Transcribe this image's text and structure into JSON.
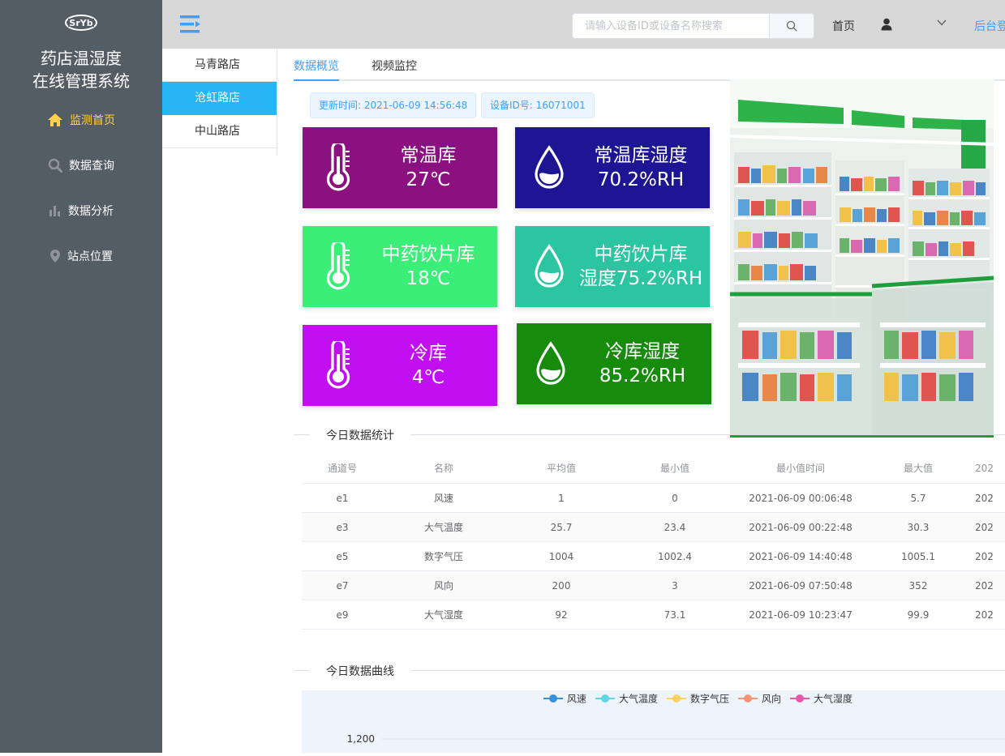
{
  "sidebar": {
    "logo_text": "SrYb",
    "title_line1": "药店温湿度",
    "title_line2": "在线管理系统",
    "items": [
      {
        "label": "监测首页",
        "icon": "home-icon",
        "active": true
      },
      {
        "label": "数据查询",
        "icon": "search-icon"
      },
      {
        "label": "数据分析",
        "icon": "bar-chart-icon"
      },
      {
        "label": "站点位置",
        "icon": "location-pin-icon"
      }
    ],
    "active_color": "#ffd04b",
    "bg_color": "#545c64"
  },
  "header": {
    "search_placeholder": "请输入设备ID或设备名称搜索",
    "home_label": "首页",
    "admin_label": "后台登"
  },
  "stores": [
    {
      "label": "马青路店"
    },
    {
      "label": "沧虹路店",
      "active": true
    },
    {
      "label": "中山路店"
    }
  ],
  "tabs": [
    {
      "label": "数据概览",
      "active": true
    },
    {
      "label": "视频监控"
    }
  ],
  "info": {
    "update_time": "更新时间: 2021-06-09 14:56:48",
    "device_id": "设备ID号: 16071001"
  },
  "cards": [
    {
      "line1": "常温库",
      "line2": "27℃",
      "icon": "thermometer-icon",
      "color": "#8c1180"
    },
    {
      "line1": "常温库湿度",
      "line2": "70.2%RH",
      "icon": "water-drop-icon",
      "color": "#1e1594"
    },
    {
      "line1": "中药饮片库",
      "line2": "18℃",
      "icon": "thermometer-icon",
      "color": "#3bee78"
    },
    {
      "line1": "中药饮片库",
      "line2": "湿度75.2%RH",
      "icon": "water-drop-icon",
      "color": "#2bc5a1"
    },
    {
      "line1": "冷库",
      "line2": "4℃",
      "icon": "thermometer-icon",
      "color": "#c20ff2"
    },
    {
      "line1": "冷库湿度",
      "line2": "85.2%RH",
      "icon": "water-drop-icon",
      "color": "#178b0c"
    }
  ],
  "stats": {
    "title": "今日数据统计",
    "columns": [
      "通道号",
      "名称",
      "平均值",
      "最小值",
      "最小值时间",
      "最大值",
      "202"
    ],
    "rows": [
      [
        "e1",
        "风速",
        "1",
        "0",
        "2021-06-09 00:06:48",
        "5.7",
        "202"
      ],
      [
        "e3",
        "大气温度",
        "25.7",
        "23.4",
        "2021-06-09 00:22:48",
        "30.3",
        "202"
      ],
      [
        "e5",
        "数字气压",
        "1004",
        "1002.4",
        "2021-06-09 14:40:48",
        "1005.1",
        "202"
      ],
      [
        "e7",
        "风向",
        "200",
        "3",
        "2021-06-09 07:50:48",
        "352",
        "202"
      ],
      [
        "e9",
        "大气湿度",
        "92",
        "73.1",
        "2021-06-09 10:23:47",
        "99.9",
        "202"
      ]
    ]
  },
  "chart_section": {
    "title": "今日数据曲线"
  },
  "chart_data": {
    "type": "line",
    "title": "",
    "series": [
      {
        "name": "风速",
        "color": "#3b8fd4"
      },
      {
        "name": "大气温度",
        "color": "#61d7e5"
      },
      {
        "name": "数字气压",
        "color": "#fdd35c"
      },
      {
        "name": "风向",
        "color": "#f79478"
      },
      {
        "name": "大气湿度",
        "color": "#e45aa9"
      }
    ],
    "y_ticks": [
      "1,200"
    ],
    "legend_position": "top-center",
    "grid": true
  }
}
